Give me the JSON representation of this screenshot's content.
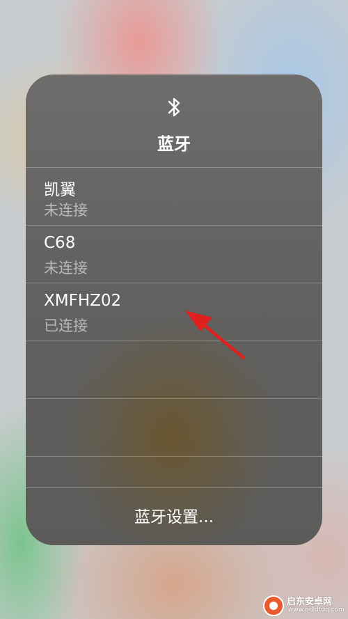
{
  "panel": {
    "title": "蓝牙",
    "icon": "bluetooth-icon",
    "devices": [
      {
        "name": "凯翼",
        "status": "未连接"
      },
      {
        "name": "C68",
        "status": "未连接"
      },
      {
        "name": "XMFHZ02",
        "status": "已连接"
      }
    ],
    "settings_label": "蓝牙设置..."
  },
  "colors": {
    "arrow": "#e0201c",
    "text": "#ffffff",
    "status_text": "#b5b4b2"
  },
  "watermark": {
    "name": "启东安卓网",
    "url": "www.qdldtdq.com"
  }
}
